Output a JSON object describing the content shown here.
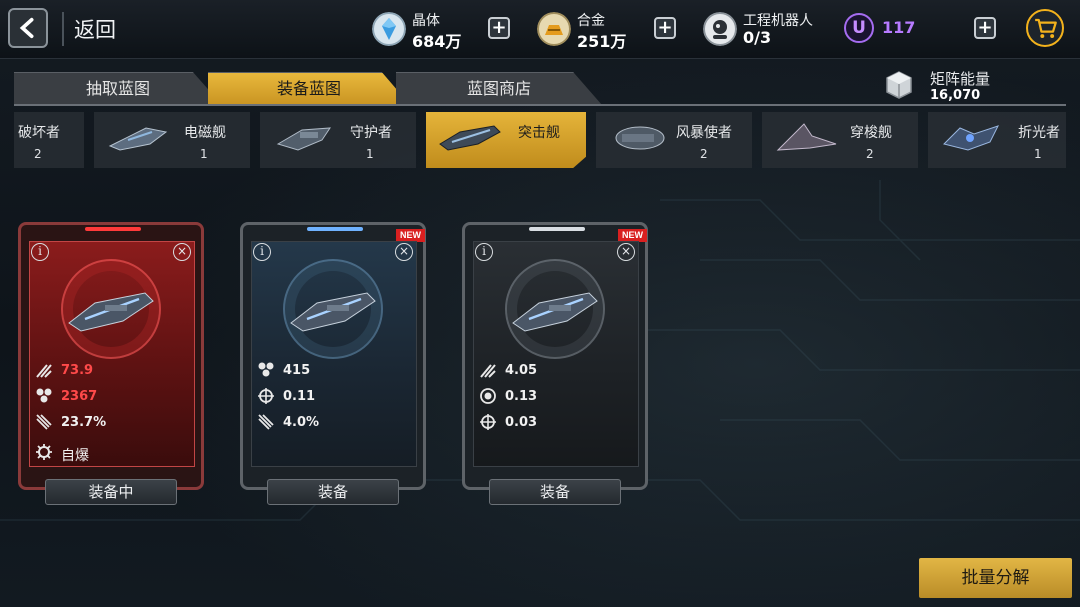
{
  "header": {
    "back_label": "返回",
    "resources": [
      {
        "name": "晶体",
        "value": "684万",
        "icon": "crystal-icon"
      },
      {
        "name": "合金",
        "value": "251万",
        "icon": "alloy-icon"
      },
      {
        "name": "工程机器人",
        "value": "0/3",
        "icon": "robot-icon"
      }
    ],
    "u_value": "117",
    "u_symbol": "U"
  },
  "tabs": [
    {
      "label": "抽取蓝图",
      "active": false
    },
    {
      "label": "装备蓝图",
      "active": true
    },
    {
      "label": "蓝图商店",
      "active": false
    }
  ],
  "matrix": {
    "name": "矩阵能量",
    "value": "16,070"
  },
  "categories": [
    {
      "name": "破坏者",
      "count": "2",
      "active": false
    },
    {
      "name": "电磁舰",
      "count": "1",
      "active": false
    },
    {
      "name": "守护者",
      "count": "1",
      "active": false
    },
    {
      "name": "突击舰",
      "count": "",
      "active": true
    },
    {
      "name": "风暴使者",
      "count": "2",
      "active": false
    },
    {
      "name": "穿梭舰",
      "count": "2",
      "active": false
    },
    {
      "name": "折光者",
      "count": "1",
      "active": false
    }
  ],
  "cards": [
    {
      "theme": "red",
      "is_new": false,
      "stats": [
        {
          "icon": "attack-icon",
          "value": "73.9"
        },
        {
          "icon": "hp-icon",
          "value": "2367"
        },
        {
          "icon": "missile-icon",
          "value": "23.7%"
        },
        {
          "icon": "gear-icon",
          "value": "自爆"
        }
      ],
      "button": "装备中"
    },
    {
      "theme": "blue",
      "is_new": true,
      "stats": [
        {
          "icon": "hp-icon",
          "value": "415"
        },
        {
          "icon": "crosshair-icon",
          "value": "0.11"
        },
        {
          "icon": "missile-icon",
          "value": "4.0%"
        }
      ],
      "button": "装备"
    },
    {
      "theme": "gray",
      "is_new": true,
      "stats": [
        {
          "icon": "attack-icon",
          "value": "4.05"
        },
        {
          "icon": "shield-ring-icon",
          "value": "0.13"
        },
        {
          "icon": "crosshair-icon",
          "value": "0.03"
        }
      ],
      "button": "装备"
    }
  ],
  "new_label": "NEW",
  "info_glyph": "i",
  "close_glyph": "×",
  "plus_glyph": "+",
  "bulk_button": "批量分解",
  "colors": {
    "gold": "#e2b645",
    "red_stat": "#ff4a4a",
    "purple": "#b77bff"
  }
}
